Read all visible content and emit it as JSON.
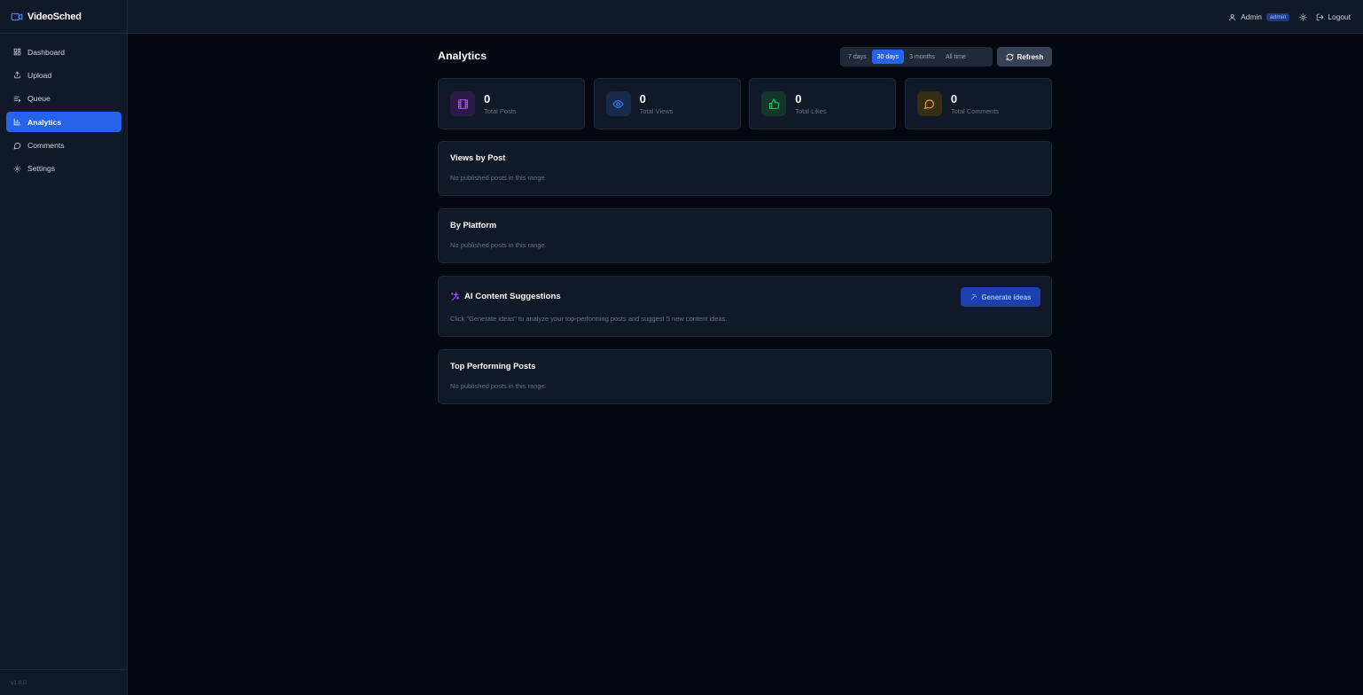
{
  "app": {
    "name": "VideoSched",
    "version": "v1.0.0"
  },
  "sidebar": {
    "items": [
      {
        "label": "Dashboard",
        "icon": "dashboard-icon"
      },
      {
        "label": "Upload",
        "icon": "upload-icon"
      },
      {
        "label": "Queue",
        "icon": "queue-icon"
      },
      {
        "label": "Analytics",
        "icon": "bar-chart-icon",
        "active": true
      },
      {
        "label": "Comments",
        "icon": "comment-icon"
      },
      {
        "label": "Settings",
        "icon": "gear-icon"
      }
    ]
  },
  "header": {
    "user_name": "Admin",
    "role": "admin",
    "logout_label": "Logout"
  },
  "page": {
    "title": "Analytics",
    "ranges": [
      "7 days",
      "30 days",
      "3 months",
      "All time"
    ],
    "selected_range": "30 days",
    "refresh_label": "Refresh"
  },
  "stats": [
    {
      "value": "0",
      "label": "Total Posts",
      "icon": "film-icon",
      "color": "#a855f7"
    },
    {
      "value": "0",
      "label": "Total Views",
      "icon": "eye-icon",
      "color": "#3b82f6"
    },
    {
      "value": "0",
      "label": "Total Likes",
      "icon": "thumbs-up-icon",
      "color": "#22c55e"
    },
    {
      "value": "0",
      "label": "Total Comments",
      "icon": "message-icon",
      "color": "#eab308"
    }
  ],
  "sections": {
    "views_by_post": {
      "title": "Views by Post",
      "empty": "No published posts in this range."
    },
    "by_platform": {
      "title": "By Platform",
      "empty": "No published posts in this range."
    },
    "ai": {
      "title": "AI Content Suggestions",
      "button": "Generate ideas",
      "description": "Click \"Generate ideas\" to analyze your top-performing posts and suggest 5 new content ideas."
    },
    "top_posts": {
      "title": "Top Performing Posts",
      "empty": "No published posts in this range."
    }
  },
  "colors": {
    "accent": "#2563eb",
    "background": "#030712",
    "panel": "#111827"
  }
}
